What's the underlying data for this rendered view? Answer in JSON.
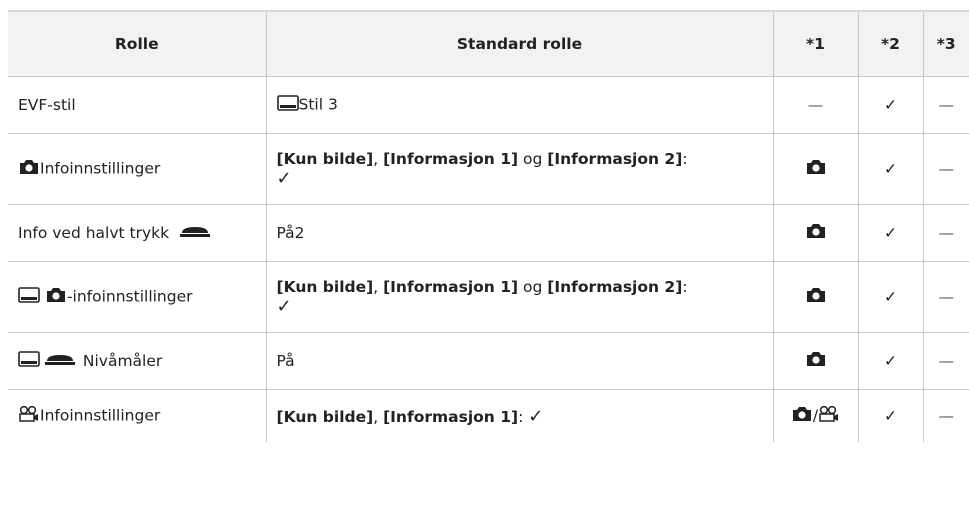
{
  "headers": {
    "role": "Rolle",
    "standard": "Standard rolle",
    "c1": "*1",
    "c2": "*2",
    "c3": "*3"
  },
  "rows": [
    {
      "role_text": "EVF-stil",
      "std_text": "Stil 3",
      "c1": "—",
      "c2": "✓",
      "c3": "—"
    },
    {
      "role_text": "Infoinnstillinger",
      "std_a": "[Kun bilde]",
      "std_b": ", ",
      "std_c": "[Informasjon 1]",
      "std_d": " og ",
      "std_e": "[Informasjon 2]",
      "std_f": ":",
      "std_check": "✓",
      "c2": "✓",
      "c3": "—"
    },
    {
      "role_text": "Info ved halvt trykk",
      "std_text": "På2",
      "c2": "✓",
      "c3": "—"
    },
    {
      "role_text": "-infoinnstillinger",
      "std_a": "[Kun bilde]",
      "std_b": ", ",
      "std_c": "[Informasjon 1]",
      "std_d": " og ",
      "std_e": "[Informasjon 2]",
      "std_f": ":",
      "std_check": "✓",
      "c2": "✓",
      "c3": "—"
    },
    {
      "role_text": "Nivåmåler",
      "std_text": "På",
      "c2": "✓",
      "c3": "—"
    },
    {
      "role_text": "Infoinnstillinger",
      "std_a": "[Kun bilde]",
      "std_b": ", ",
      "std_c": "[Informasjon 1]",
      "std_f": ": ",
      "std_check": "✓",
      "c1_sep": "/",
      "c2": "✓",
      "c3": "—"
    }
  ],
  "icons": {
    "monitor": "monitor-icon",
    "camera": "camera-icon",
    "shutter": "shutter-button-icon",
    "movie": "movie-camera-icon"
  }
}
